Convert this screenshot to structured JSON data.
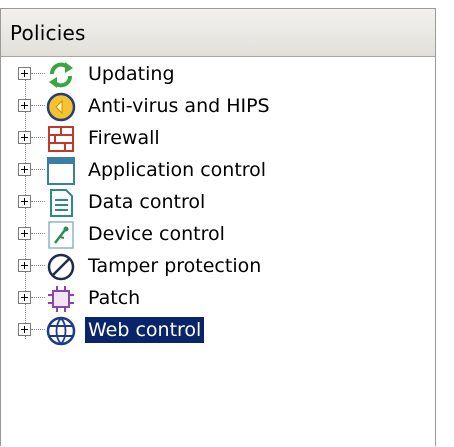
{
  "panel": {
    "title": "Policies"
  },
  "tree": {
    "items": [
      {
        "label": "Updating",
        "icon": "updating-icon"
      },
      {
        "label": "Anti-virus and HIPS",
        "icon": "anti-virus-icon"
      },
      {
        "label": "Firewall",
        "icon": "firewall-icon"
      },
      {
        "label": "Application control",
        "icon": "application-control-icon"
      },
      {
        "label": "Data control",
        "icon": "data-control-icon"
      },
      {
        "label": "Device control",
        "icon": "device-control-icon"
      },
      {
        "label": "Tamper protection",
        "icon": "tamper-protection-icon"
      },
      {
        "label": "Patch",
        "icon": "patch-icon"
      },
      {
        "label": "Web control",
        "icon": "web-control-icon",
        "selected": true
      }
    ]
  },
  "colors": {
    "selection": "#0a246a",
    "header": "#e8e6e1"
  }
}
